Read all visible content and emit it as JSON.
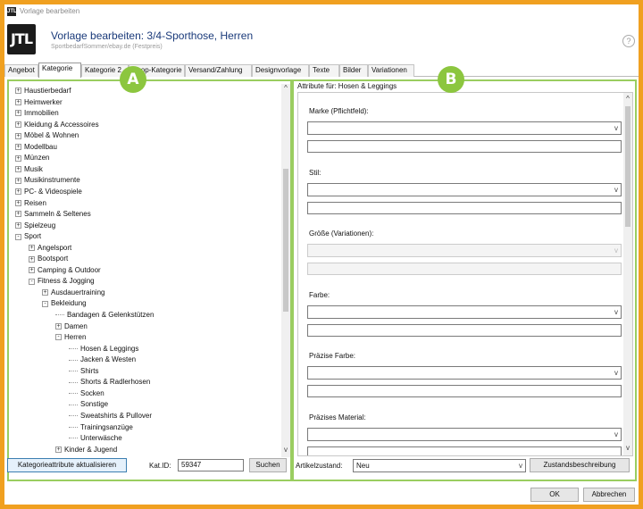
{
  "window": {
    "title": "Vorlage bearbeiten",
    "app_icon": "JTL"
  },
  "header": {
    "logo": "JTL",
    "title": "Vorlage bearbeiten: 3/4-Sporthose, Herren",
    "subtitle": "SportbedarfSommer/ebay.de (Festpreis)",
    "help": "?"
  },
  "tabs": [
    "Angebot",
    "Kategorie",
    "Kategorie 2",
    "Shop-Kategorie",
    "Versand/Zahlung",
    "Designvorlage",
    "Texte",
    "Bilder",
    "Variationen"
  ],
  "active_tab": "Kategorie",
  "badges": {
    "a": "A",
    "b": "B"
  },
  "tree": [
    {
      "label": "Haustierbedarf",
      "level": 0,
      "exp": "+"
    },
    {
      "label": "Heimwerker",
      "level": 0,
      "exp": "+"
    },
    {
      "label": "Immobilien",
      "level": 0,
      "exp": "+"
    },
    {
      "label": "Kleidung & Accessoires",
      "level": 0,
      "exp": "+"
    },
    {
      "label": "Möbel & Wohnen",
      "level": 0,
      "exp": "+"
    },
    {
      "label": "Modellbau",
      "level": 0,
      "exp": "+"
    },
    {
      "label": "Münzen",
      "level": 0,
      "exp": "+"
    },
    {
      "label": "Musik",
      "level": 0,
      "exp": "+"
    },
    {
      "label": "Musikinstrumente",
      "level": 0,
      "exp": "+"
    },
    {
      "label": "PC- & Videospiele",
      "level": 0,
      "exp": "+"
    },
    {
      "label": "Reisen",
      "level": 0,
      "exp": "+"
    },
    {
      "label": "Sammeln & Seltenes",
      "level": 0,
      "exp": "+"
    },
    {
      "label": "Spielzeug",
      "level": 0,
      "exp": "+"
    },
    {
      "label": "Sport",
      "level": 0,
      "exp": "-"
    },
    {
      "label": "Angelsport",
      "level": 1,
      "exp": "+"
    },
    {
      "label": "Bootsport",
      "level": 1,
      "exp": "+"
    },
    {
      "label": "Camping & Outdoor",
      "level": 1,
      "exp": "+"
    },
    {
      "label": "Fitness & Jogging",
      "level": 1,
      "exp": "-"
    },
    {
      "label": "Ausdauertraining",
      "level": 2,
      "exp": "+"
    },
    {
      "label": "Bekleidung",
      "level": 2,
      "exp": "-"
    },
    {
      "label": "Bandagen & Gelenkstützen",
      "level": 3,
      "exp": ""
    },
    {
      "label": "Damen",
      "level": 3,
      "exp": "+"
    },
    {
      "label": "Herren",
      "level": 3,
      "exp": "-"
    },
    {
      "label": "Hosen & Leggings",
      "level": 4,
      "exp": ""
    },
    {
      "label": "Jacken & Westen",
      "level": 4,
      "exp": ""
    },
    {
      "label": "Shirts",
      "level": 4,
      "exp": ""
    },
    {
      "label": "Shorts & Radlerhosen",
      "level": 4,
      "exp": ""
    },
    {
      "label": "Socken",
      "level": 4,
      "exp": ""
    },
    {
      "label": "Sonstige",
      "level": 4,
      "exp": ""
    },
    {
      "label": "Sweatshirts & Pullover",
      "level": 4,
      "exp": ""
    },
    {
      "label": "Trainingsanzüge",
      "level": 4,
      "exp": ""
    },
    {
      "label": "Unterwäsche",
      "level": 4,
      "exp": ""
    },
    {
      "label": "Kinder & Jugend",
      "level": 3,
      "exp": "+"
    }
  ],
  "left_bottom": {
    "refresh_button": "Kategorieattribute aktualisieren",
    "katid_label": "Kat.ID:",
    "katid_value": "59347",
    "search_button": "Suchen"
  },
  "attributes": {
    "heading": "Attribute für: Hosen & Leggings",
    "fields": [
      {
        "label": "Marke (Pflichtfeld):",
        "disabled": false
      },
      {
        "label": "Stil:",
        "disabled": false
      },
      {
        "label": "Größe (Variationen):",
        "disabled": true
      },
      {
        "label": "Farbe:",
        "disabled": false
      },
      {
        "label": "Präzise Farbe:",
        "disabled": false
      },
      {
        "label": "Präzises Material:",
        "disabled": false
      }
    ]
  },
  "right_bottom": {
    "condition_label": "Artikelzustand:",
    "condition_value": "Neu",
    "condition_desc_button": "Zustandsbeschreibung"
  },
  "footer": {
    "ok": "OK",
    "cancel": "Abbrechen"
  },
  "colors": {
    "frame": "#f0a020",
    "highlight": "#9acd60",
    "badge": "#8cc63f",
    "title": "#1a3a7a"
  }
}
